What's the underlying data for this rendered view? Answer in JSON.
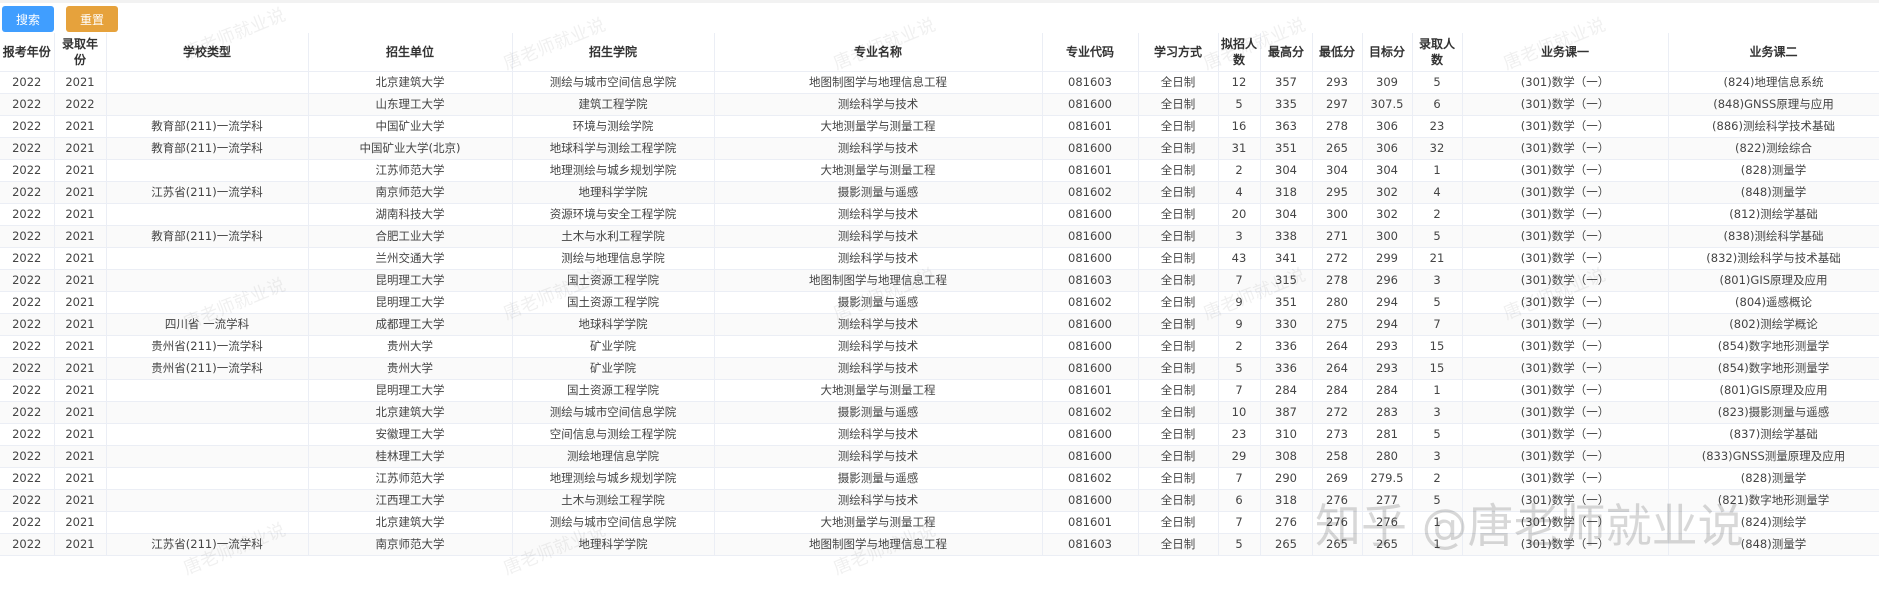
{
  "toolbar": {
    "search_label": "搜索",
    "reset_label": "重置"
  },
  "columns": [
    "报考年份",
    "录取年份",
    "学校类型",
    "招生单位",
    "招生学院",
    "专业名称",
    "专业代码",
    "学习方式",
    "拟招人数",
    "最高分",
    "最低分",
    "目标分",
    "录取人数",
    "业务课一",
    "业务课二"
  ],
  "rows": [
    [
      "2022",
      "2021",
      "",
      "北京建筑大学",
      "测绘与城市空间信息学院",
      "地图制图学与地理信息工程",
      "081603",
      "全日制",
      "12",
      "357",
      "293",
      "309",
      "5",
      "(301)数学（一）",
      "(824)地理信息系统"
    ],
    [
      "2022",
      "2022",
      "",
      "山东理工大学",
      "建筑工程学院",
      "测绘科学与技术",
      "081600",
      "全日制",
      "5",
      "335",
      "297",
      "307.5",
      "6",
      "(301)数学（一）",
      "(848)GNSS原理与应用"
    ],
    [
      "2022",
      "2021",
      "教育部(211)一流学科",
      "中国矿业大学",
      "环境与测绘学院",
      "大地测量学与测量工程",
      "081601",
      "全日制",
      "16",
      "363",
      "278",
      "306",
      "23",
      "(301)数学（一）",
      "(886)测绘科学技术基础"
    ],
    [
      "2022",
      "2021",
      "教育部(211)一流学科",
      "中国矿业大学(北京)",
      "地球科学与测绘工程学院",
      "测绘科学与技术",
      "081600",
      "全日制",
      "31",
      "351",
      "265",
      "306",
      "32",
      "(301)数学（一）",
      "(822)测绘综合"
    ],
    [
      "2022",
      "2021",
      "",
      "江苏师范大学",
      "地理测绘与城乡规划学院",
      "大地测量学与测量工程",
      "081601",
      "全日制",
      "2",
      "304",
      "304",
      "304",
      "1",
      "(301)数学（一）",
      "(828)测量学"
    ],
    [
      "2022",
      "2021",
      "江苏省(211)一流学科",
      "南京师范大学",
      "地理科学学院",
      "摄影测量与遥感",
      "081602",
      "全日制",
      "4",
      "318",
      "295",
      "302",
      "4",
      "(301)数学（一）",
      "(848)测量学"
    ],
    [
      "2022",
      "2021",
      "",
      "湖南科技大学",
      "资源环境与安全工程学院",
      "测绘科学与技术",
      "081600",
      "全日制",
      "20",
      "304",
      "300",
      "302",
      "2",
      "(301)数学（一）",
      "(812)测绘学基础"
    ],
    [
      "2022",
      "2021",
      "教育部(211)一流学科",
      "合肥工业大学",
      "土木与水利工程学院",
      "测绘科学与技术",
      "081600",
      "全日制",
      "3",
      "338",
      "271",
      "300",
      "5",
      "(301)数学（一）",
      "(838)测绘科学基础"
    ],
    [
      "2022",
      "2021",
      "",
      "兰州交通大学",
      "测绘与地理信息学院",
      "测绘科学与技术",
      "081600",
      "全日制",
      "43",
      "341",
      "272",
      "299",
      "21",
      "(301)数学（一）",
      "(832)测绘科学与技术基础"
    ],
    [
      "2022",
      "2021",
      "",
      "昆明理工大学",
      "国土资源工程学院",
      "地图制图学与地理信息工程",
      "081603",
      "全日制",
      "7",
      "315",
      "278",
      "296",
      "3",
      "(301)数学（一）",
      "(801)GIS原理及应用"
    ],
    [
      "2022",
      "2021",
      "",
      "昆明理工大学",
      "国土资源工程学院",
      "摄影测量与遥感",
      "081602",
      "全日制",
      "9",
      "351",
      "280",
      "294",
      "5",
      "(301)数学（一）",
      "(804)遥感概论"
    ],
    [
      "2022",
      "2021",
      "四川省 一流学科",
      "成都理工大学",
      "地球科学学院",
      "测绘科学与技术",
      "081600",
      "全日制",
      "9",
      "330",
      "275",
      "294",
      "7",
      "(301)数学（一）",
      "(802)测绘学概论"
    ],
    [
      "2022",
      "2021",
      "贵州省(211)一流学科",
      "贵州大学",
      "矿业学院",
      "测绘科学与技术",
      "081600",
      "全日制",
      "2",
      "336",
      "264",
      "293",
      "15",
      "(301)数学（一）",
      "(854)数字地形测量学"
    ],
    [
      "2022",
      "2021",
      "贵州省(211)一流学科",
      "贵州大学",
      "矿业学院",
      "测绘科学与技术",
      "081600",
      "全日制",
      "5",
      "336",
      "264",
      "293",
      "15",
      "(301)数学（一）",
      "(854)数字地形测量学"
    ],
    [
      "2022",
      "2021",
      "",
      "昆明理工大学",
      "国土资源工程学院",
      "大地测量学与测量工程",
      "081601",
      "全日制",
      "7",
      "284",
      "284",
      "284",
      "1",
      "(301)数学（一）",
      "(801)GIS原理及应用"
    ],
    [
      "2022",
      "2021",
      "",
      "北京建筑大学",
      "测绘与城市空间信息学院",
      "摄影测量与遥感",
      "081602",
      "全日制",
      "10",
      "387",
      "272",
      "283",
      "3",
      "(301)数学（一）",
      "(823)摄影测量与遥感"
    ],
    [
      "2022",
      "2021",
      "",
      "安徽理工大学",
      "空间信息与测绘工程学院",
      "测绘科学与技术",
      "081600",
      "全日制",
      "23",
      "310",
      "273",
      "281",
      "5",
      "(301)数学（一）",
      "(837)测绘学基础"
    ],
    [
      "2022",
      "2021",
      "",
      "桂林理工大学",
      "测绘地理信息学院",
      "测绘科学与技术",
      "081600",
      "全日制",
      "29",
      "308",
      "258",
      "280",
      "3",
      "(301)数学（一）",
      "(833)GNSS测量原理及应用"
    ],
    [
      "2022",
      "2021",
      "",
      "江苏师范大学",
      "地理测绘与城乡规划学院",
      "摄影测量与遥感",
      "081602",
      "全日制",
      "7",
      "290",
      "269",
      "279.5",
      "2",
      "(301)数学（一）",
      "(828)测量学"
    ],
    [
      "2022",
      "2021",
      "",
      "江西理工大学",
      "土木与测绘工程学院",
      "测绘科学与技术",
      "081600",
      "全日制",
      "6",
      "318",
      "276",
      "277",
      "5",
      "(301)数学（一）",
      "(821)数字地形测量学"
    ],
    [
      "2022",
      "2021",
      "",
      "北京建筑大学",
      "测绘与城市空间信息学院",
      "大地测量学与测量工程",
      "081601",
      "全日制",
      "7",
      "276",
      "276",
      "276",
      "1",
      "(301)数学（一）",
      "(824)测绘学"
    ],
    [
      "2022",
      "2021",
      "江苏省(211)一流学科",
      "南京师范大学",
      "地理科学学院",
      "地图制图学与地理信息工程",
      "081603",
      "全日制",
      "5",
      "265",
      "265",
      "265",
      "1",
      "(301)数学（一）",
      "(848)测量学"
    ]
  ],
  "watermark": {
    "text": "唐老师就业说",
    "big_text": "知乎 @唐老师就业说"
  }
}
